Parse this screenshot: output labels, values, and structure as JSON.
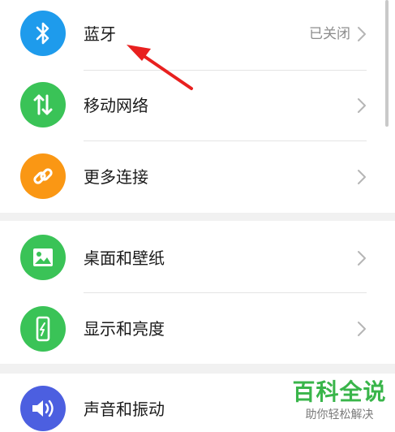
{
  "section1": {
    "items": [
      {
        "label": "蓝牙",
        "value": "已关闭",
        "icon": "bluetooth-icon",
        "color": "#1e9bec"
      },
      {
        "label": "移动网络",
        "value": "",
        "icon": "mobile-data-icon",
        "color": "#3ac357"
      },
      {
        "label": "更多连接",
        "value": "",
        "icon": "link-icon",
        "color": "#fa9714"
      }
    ]
  },
  "section2": {
    "items": [
      {
        "label": "桌面和壁纸",
        "icon": "wallpaper-icon",
        "color": "#3ac357"
      },
      {
        "label": "显示和亮度",
        "icon": "display-icon",
        "color": "#3ac357"
      }
    ]
  },
  "section3": {
    "items": [
      {
        "label": "声音和振动",
        "icon": "sound-icon",
        "color": "#4c5fe0"
      }
    ]
  },
  "annotation": {
    "color": "#e8201f"
  },
  "watermark": {
    "title": "百科全说",
    "subtitle": "助你轻松解决",
    "color": "#39b54a"
  }
}
